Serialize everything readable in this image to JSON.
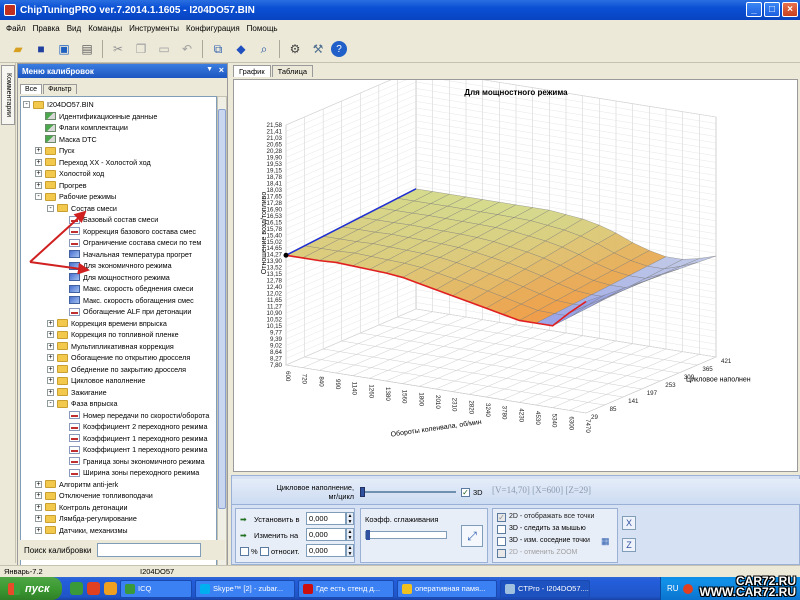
{
  "window": {
    "title": "ChipTuningPRO ver.7.2014.1.1605 - I204DO57.BIN"
  },
  "menu": [
    "Файл",
    "Правка",
    "Вид",
    "Команды",
    "Инструменты",
    "Конфигурация",
    "Помощь"
  ],
  "side_tab": "Комментарии",
  "calibration_menu": {
    "title": "Меню калибровок",
    "tabs": [
      "Все",
      "Фильтр"
    ],
    "tree": [
      {
        "level": 1,
        "exp": "-",
        "icon": "folder",
        "label": "I204DO57.BIN"
      },
      {
        "level": 2,
        "exp": "",
        "icon": "flag",
        "label": "Идентификационные данные"
      },
      {
        "level": 2,
        "exp": "",
        "icon": "flag",
        "label": "Флаги комплектации"
      },
      {
        "level": 2,
        "exp": "",
        "icon": "flag",
        "label": "Маска DTC"
      },
      {
        "level": 2,
        "exp": "+",
        "icon": "folder",
        "label": "Пуск"
      },
      {
        "level": 2,
        "exp": "+",
        "icon": "folder",
        "label": "Переход XX - Холостой ход"
      },
      {
        "level": 2,
        "exp": "+",
        "icon": "folder",
        "label": "Холостой ход"
      },
      {
        "level": 2,
        "exp": "+",
        "icon": "folder",
        "label": "Прогрев"
      },
      {
        "level": 2,
        "exp": "-",
        "icon": "folder",
        "label": "Рабочие режимы"
      },
      {
        "level": 3,
        "exp": "-",
        "icon": "folder",
        "label": "Состав смеси"
      },
      {
        "level": 4,
        "exp": "",
        "icon": "graph",
        "label": "Базовый состав смеси"
      },
      {
        "level": 4,
        "exp": "",
        "icon": "graph",
        "label": "Коррекция базового состава смес"
      },
      {
        "level": 4,
        "exp": "",
        "icon": "graph",
        "label": "Ограничение состава смеси по тем"
      },
      {
        "level": 4,
        "exp": "",
        "icon": "graph3d",
        "label": "Начальная температура прогрет"
      },
      {
        "level": 4,
        "exp": "",
        "icon": "graph3d",
        "label": "Для экономичного режима"
      },
      {
        "level": 4,
        "exp": "",
        "icon": "graph3d",
        "label": "Для мощностного режима"
      },
      {
        "level": 4,
        "exp": "",
        "icon": "graph3d",
        "label": "Макс. скорость обеднения смеси"
      },
      {
        "level": 4,
        "exp": "",
        "icon": "graph3d",
        "label": "Макс. скорость обогащения смес"
      },
      {
        "level": 4,
        "exp": "",
        "icon": "graph",
        "label": "Обогащение ALF при детонации"
      },
      {
        "level": 3,
        "exp": "+",
        "icon": "folder",
        "label": "Коррекция времени впрыска"
      },
      {
        "level": 3,
        "exp": "+",
        "icon": "folder",
        "label": "Коррекция по топливной пленке"
      },
      {
        "level": 3,
        "exp": "+",
        "icon": "folder",
        "label": "Мультипликативная коррекция"
      },
      {
        "level": 3,
        "exp": "+",
        "icon": "folder",
        "label": "Обогащение по открытию дросселя"
      },
      {
        "level": 3,
        "exp": "+",
        "icon": "folder",
        "label": "Обеднение по закрытию дросселя"
      },
      {
        "level": 3,
        "exp": "+",
        "icon": "folder",
        "label": "Цикловое наполнение"
      },
      {
        "level": 3,
        "exp": "+",
        "icon": "folder",
        "label": "Зажигание"
      },
      {
        "level": 3,
        "exp": "-",
        "icon": "folder",
        "label": "Фаза впрыска"
      },
      {
        "level": 4,
        "exp": "",
        "icon": "graph",
        "label": "Номер передачи по скорости/оборота"
      },
      {
        "level": 4,
        "exp": "",
        "icon": "graph",
        "label": "Коэффициент 2 переходного режима"
      },
      {
        "level": 4,
        "exp": "",
        "icon": "graph",
        "label": "Коэффициент 1 переходного режима"
      },
      {
        "level": 4,
        "exp": "",
        "icon": "graph",
        "label": "Коэффициент 1 переходного режима"
      },
      {
        "level": 4,
        "exp": "",
        "icon": "graph",
        "label": "Граница зоны экономичного режима"
      },
      {
        "level": 4,
        "exp": "",
        "icon": "graph",
        "label": "Ширина зоны переходного режима"
      },
      {
        "level": 2,
        "exp": "+",
        "icon": "folder",
        "label": "Алгоритм anti-jerk"
      },
      {
        "level": 2,
        "exp": "+",
        "icon": "folder",
        "label": "Отключение топливоподачи"
      },
      {
        "level": 2,
        "exp": "+",
        "icon": "folder",
        "label": "Контроль детонации"
      },
      {
        "level": 2,
        "exp": "+",
        "icon": "folder",
        "label": "Лямбда-регулирование"
      },
      {
        "level": 2,
        "exp": "+",
        "icon": "folder",
        "label": "Датчики, механизмы"
      }
    ],
    "search_label": "Поиск калибровки",
    "search_value": ""
  },
  "chart_tabs": [
    "График",
    "Таблица"
  ],
  "chart_data": {
    "type": "surface3d",
    "title": "Для мощностного режима",
    "xlabel": "Обороты коленвала, об/мин",
    "ylabel": "Цикловое наполнен",
    "zlabel": "Отношение возд/топливо",
    "x_ticks": [
      "600",
      "720",
      "840",
      "990",
      "1140",
      "1260",
      "1380",
      "1560",
      "1800",
      "2010",
      "2310",
      "2820",
      "3240",
      "3780",
      "4230",
      "4530",
      "5340",
      "6300",
      "7470"
    ],
    "y_ticks": [
      "29",
      "85",
      "141",
      "197",
      "253",
      "309",
      "365",
      "421"
    ],
    "z_ticks": [
      "7,80",
      "8,27",
      "8,64",
      "9,02",
      "9,39",
      "9,77",
      "10,15",
      "10,52",
      "10,90",
      "11,27",
      "11,65",
      "12,02",
      "12,40",
      "12,78",
      "13,15",
      "13,52",
      "13,90",
      "14,27",
      "14,65",
      "15,02",
      "15,40",
      "15,78",
      "16,15",
      "16,53",
      "16,90",
      "17,28",
      "17,65",
      "18,03",
      "18,41",
      "18,78",
      "19,15",
      "19,53",
      "19,90",
      "20,28",
      "20,65",
      "21,03",
      "21,41",
      "21,58"
    ],
    "front_edge_afr": [
      14.1,
      14.1,
      14.1,
      14.15,
      14.1,
      14.05,
      14.0,
      13.9,
      13.7,
      13.5,
      13.3,
      13.1,
      12.9,
      12.7,
      12.5,
      12.5,
      12.5,
      13.4,
      14.2
    ],
    "back_edge_afr": [
      14.7,
      14.7,
      14.7,
      14.7,
      14.7,
      14.7,
      14.7,
      14.7,
      14.7,
      14.6,
      14.5,
      14.3,
      14.0,
      13.6,
      13.3,
      13.1,
      13.1,
      13.3,
      13.6
    ],
    "axis_range_z": [
      7.8,
      21.58
    ],
    "grid": true
  },
  "controls": {
    "fill_label": "Цикловое наполнение,\nмг/цикл",
    "fill_value_fraction": 0.0,
    "checkbox_3d_label": "3D",
    "checkbox_3d_checked": true,
    "readout": "[V=14,70] [X=600] [Z=29]",
    "set_label": "Установить в",
    "set_value": "0,000",
    "change_label": "Изменить на",
    "change_value": "0,000",
    "percent_label": "%",
    "relative_label": "относит.",
    "relative_value": "0,000",
    "smoothing_label": "Коэфф. сглаживания",
    "smoothing_fraction": 0.0,
    "opt_2d_all": "2D - отображать все точки",
    "opt_3d_mouse": "3D - следить за мышью",
    "opt_3d_neighbors": "3D - изм. соседние точки",
    "opt_2d_zoom": "2D - отменить ZOOM",
    "btn_x": "X",
    "btn_z": "Z"
  },
  "status": {
    "left": "Январь-7.2",
    "right": "I204DO57"
  },
  "taskbar": {
    "start": "пуск",
    "items": [
      "ICQ",
      "Skype™ [2] - zubar...",
      "Где есть стенд д...",
      "оперативная памя...",
      "CTPro - I204DO57...."
    ],
    "lang": "RU",
    "watermark": "CAR72.RU\nWWW.CAR72.RU"
  }
}
